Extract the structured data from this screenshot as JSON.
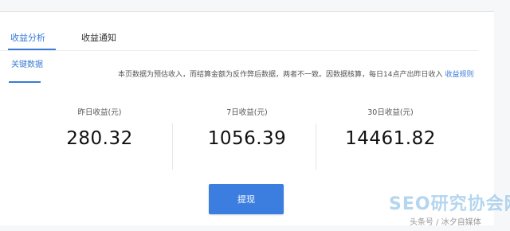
{
  "tabs": [
    {
      "label": "收益分析",
      "active": true
    },
    {
      "label": "收益通知",
      "active": false
    }
  ],
  "subtab": {
    "label": "关键数据"
  },
  "notice": {
    "text": "本页数据为预估收入，而结算金额为反作弊后数据，两者不一致。因数据核算，每日14点产出昨日收入",
    "rules_link": "收益规则"
  },
  "stats": [
    {
      "label": "昨日收益(元)",
      "value": "280.32"
    },
    {
      "label": "7日收益(元)",
      "value": "1056.39"
    },
    {
      "label": "30日收益(元)",
      "value": "14461.82"
    }
  ],
  "withdraw_button": {
    "label": "提现"
  },
  "watermark": {
    "logo_text": "SEO研究协会网",
    "author": "头条号 / 冰夕自媒体"
  },
  "colors": {
    "accent": "#3a7bd5",
    "button": "#3b7ee0"
  }
}
